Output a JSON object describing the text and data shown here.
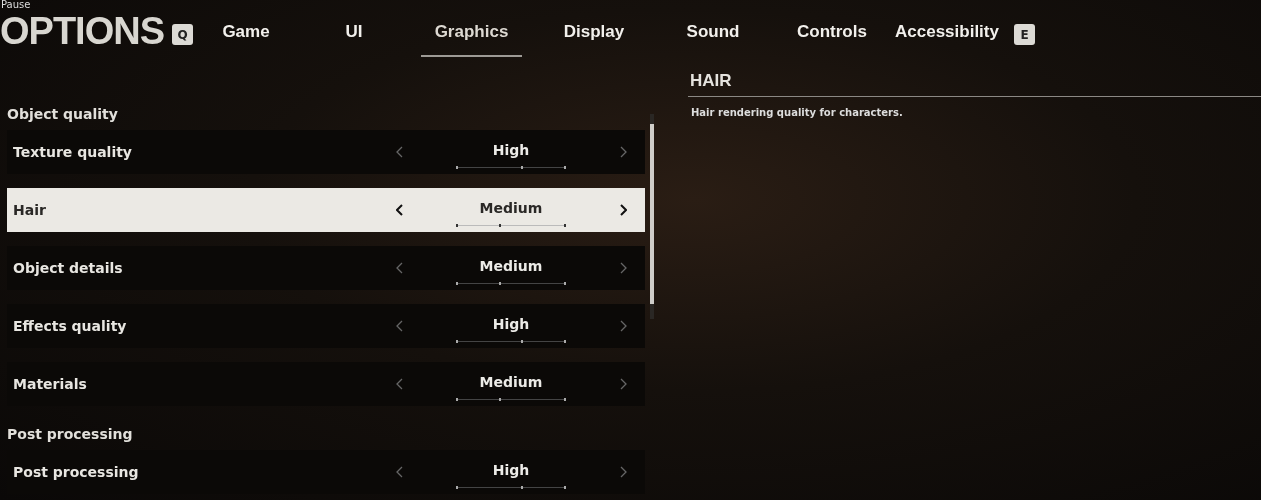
{
  "header": {
    "caption": "Pause",
    "title": "OPTIONS",
    "prev_key": "Q",
    "next_key": "E"
  },
  "tabs": [
    {
      "label": "Game",
      "selected": false
    },
    {
      "label": "UI",
      "selected": false
    },
    {
      "label": "Graphics",
      "selected": true
    },
    {
      "label": "Display",
      "selected": false
    },
    {
      "label": "Sound",
      "selected": false
    },
    {
      "label": "Controls",
      "selected": false
    },
    {
      "label": "Accessibility",
      "selected": false
    }
  ],
  "sections": [
    {
      "title": "Object quality",
      "rows": [
        {
          "label": "Texture quality",
          "value": "High",
          "level": 0.6,
          "selected": false
        },
        {
          "label": "Hair",
          "value": "Medium",
          "level": 0.4,
          "selected": true
        },
        {
          "label": "Object details",
          "value": "Medium",
          "level": 0.4,
          "selected": false
        },
        {
          "label": "Effects quality",
          "value": "High",
          "level": 0.6,
          "selected": false
        },
        {
          "label": "Materials",
          "value": "Medium",
          "level": 0.4,
          "selected": false
        }
      ]
    },
    {
      "title": "Post processing",
      "rows": [
        {
          "label": "Post processing",
          "value": "High",
          "level": 0.6,
          "selected": false
        }
      ]
    }
  ],
  "detail": {
    "title": "HAIR",
    "description": "Hair rendering quality for characters."
  }
}
